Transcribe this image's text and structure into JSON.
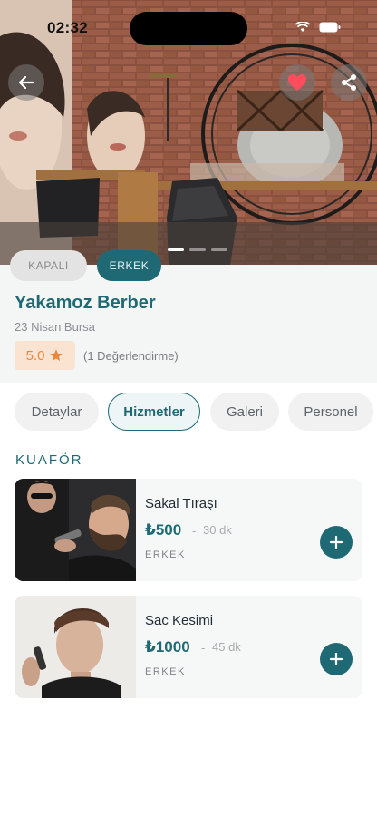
{
  "status_bar": {
    "time": "02:32"
  },
  "hero": {
    "icons": [
      "back-arrow-icon",
      "heart-icon",
      "share-icon"
    ],
    "slide_count": 3,
    "active_slide": 1
  },
  "shop": {
    "status_tag": "KAPALI",
    "gender_tag": "ERKEK",
    "name": "Yakamoz Berber",
    "location": "23 Nisan Bursa",
    "rating": "5.0",
    "rating_count": "(1 Değerlendirme)"
  },
  "tabs": [
    {
      "label": "Detaylar",
      "active": false
    },
    {
      "label": "Hizmetler",
      "active": true
    },
    {
      "label": "Galeri",
      "active": false
    },
    {
      "label": "Personel",
      "active": false
    }
  ],
  "services_section": {
    "title": "KUAFÖR",
    "items": [
      {
        "name": "Sakal Tıraşı",
        "price": "₺500",
        "separator": "-",
        "duration": "30 dk",
        "gender": "ERKEK"
      },
      {
        "name": "Sac Kesimi",
        "price": "₺1000",
        "separator": "-",
        "duration": "45 dk",
        "gender": "ERKEK"
      }
    ]
  },
  "colors": {
    "brand": "#1f6975",
    "rating_accent": "#e8873e",
    "favorite": "#ff4d5e"
  }
}
